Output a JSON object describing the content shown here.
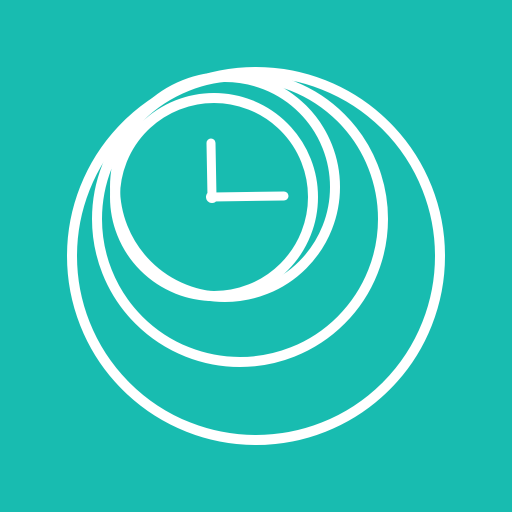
{
  "app_icon": {
    "icon": "clock-ripple-icon",
    "colors": {
      "background": "#18BCB0",
      "foreground": "#FFFFFF"
    }
  }
}
